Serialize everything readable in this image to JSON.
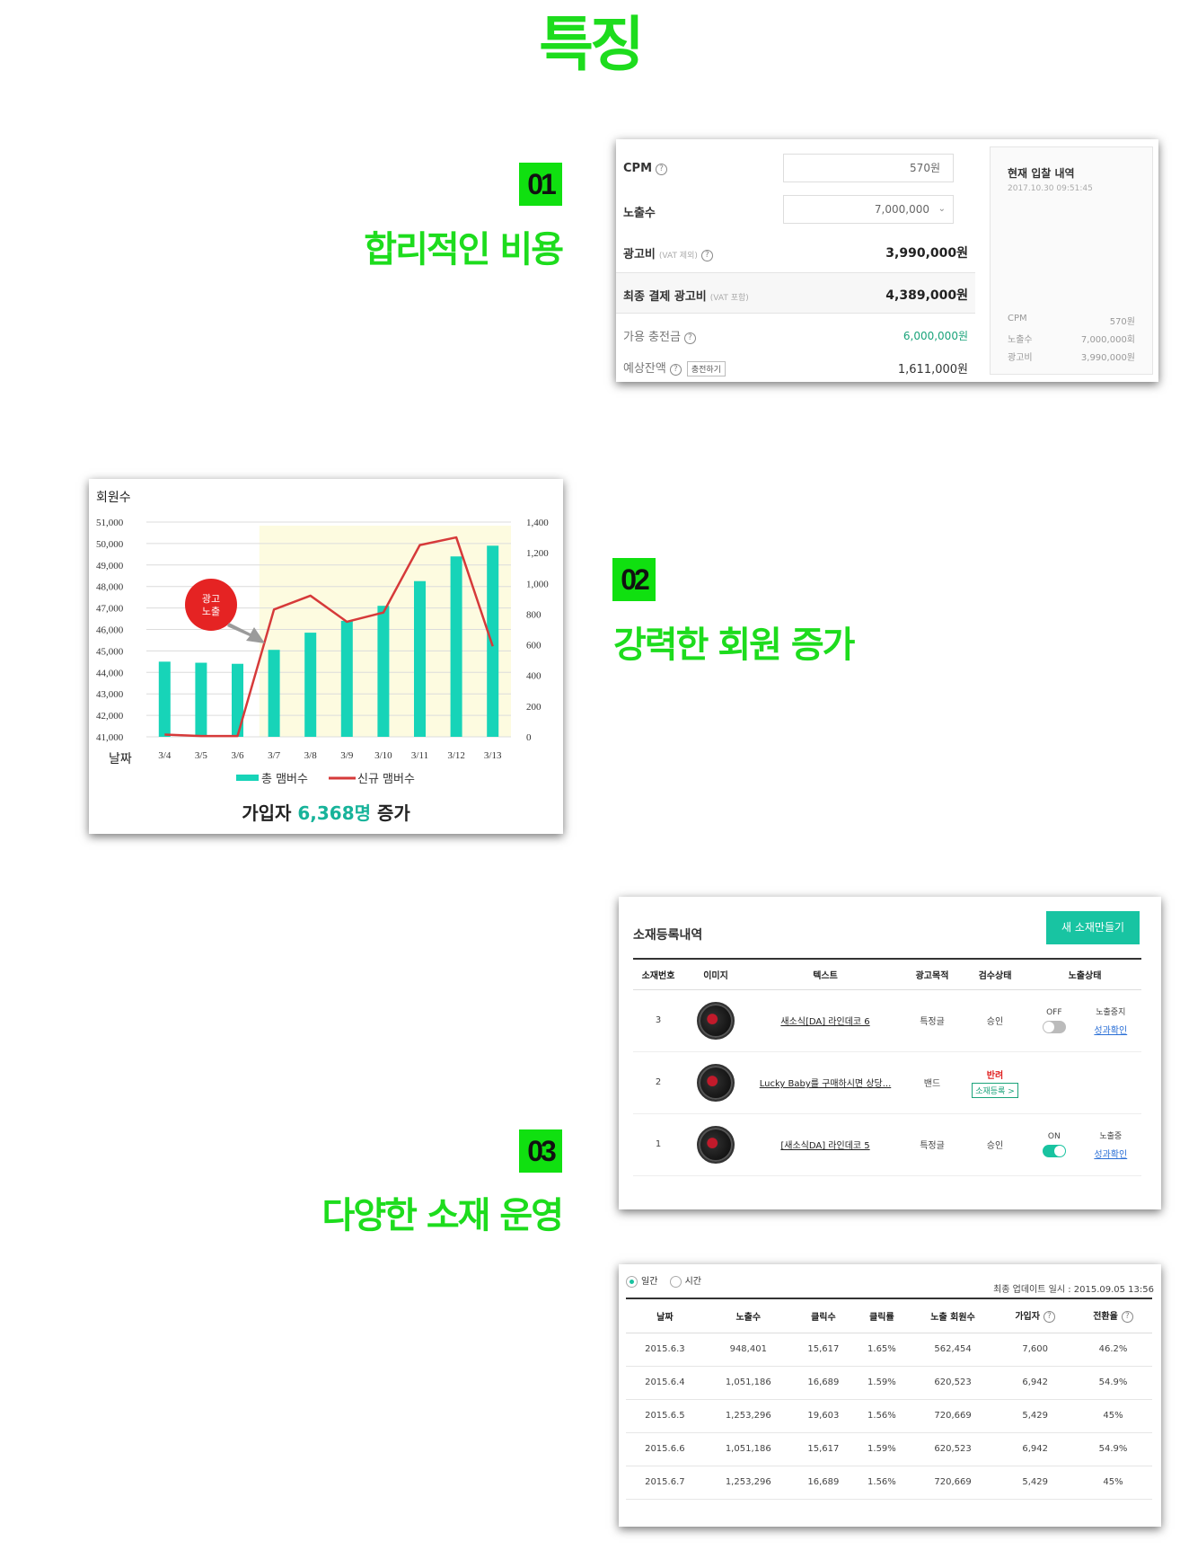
{
  "page": {
    "title": "특징"
  },
  "features": [
    {
      "number": "01",
      "title": "합리적인 비용"
    },
    {
      "number": "02",
      "title": "강력한 회원 증가"
    },
    {
      "number": "03",
      "title": "다양한 소재 운영"
    }
  ],
  "cost_card": {
    "cpm_label": "CPM",
    "cpm_value": "570원",
    "impressions_label": "노출수",
    "impressions_value": "7,000,000",
    "ad_cost_label": "광고비",
    "ad_cost_sub": "(VAT 제외)",
    "ad_cost_value": "3,990,000원",
    "final_label": "최종 결제 광고비",
    "final_sub": "(VAT 포함)",
    "final_value": "4,389,000원",
    "available_label": "가용 충전금",
    "available_value": "6,000,000원",
    "expected_label": "예상잔액",
    "charge_button": "충전하기",
    "expected_value": "1,611,000원",
    "history": {
      "title": "현재 입찰 내역",
      "timestamp": "2017.10.30 09:51:45",
      "rows": [
        {
          "label": "CPM",
          "value": "570원"
        },
        {
          "label": "노출수",
          "value": "7,000,000회"
        },
        {
          "label": "광고비",
          "value": "3,990,000원"
        }
      ]
    }
  },
  "member_card": {
    "caption_prefix": "가입자 ",
    "caption_highlight": "6,368명",
    "caption_suffix": " 증가",
    "callout": "광고\n노출"
  },
  "chart_data": {
    "type": "bar",
    "title": "",
    "ylabel": "회원수",
    "xlabel": "날짜",
    "categories": [
      "3/4",
      "3/5",
      "3/6",
      "3/7",
      "3/8",
      "3/9",
      "3/10",
      "3/11",
      "3/12",
      "3/13"
    ],
    "left_axis": {
      "min": 41000,
      "max": 51000,
      "ticks": [
        "41,000",
        "42,000",
        "43,000",
        "44,000",
        "45,000",
        "46,000",
        "47,000",
        "48,000",
        "49,000",
        "50,000",
        "51,000"
      ]
    },
    "right_axis": {
      "min": 0,
      "max": 1400,
      "ticks": [
        "0",
        "200",
        "400",
        "600",
        "800",
        "1,000",
        "1,200",
        "1,400"
      ]
    },
    "series": [
      {
        "name": "총 맴버수",
        "type": "bar",
        "axis": "left",
        "color": "#17d4b8",
        "values": [
          44500,
          44450,
          44400,
          45050,
          45850,
          46400,
          47100,
          48250,
          49400,
          49900
        ]
      },
      {
        "name": "신규 맴버수",
        "type": "line",
        "axis": "right",
        "color": "#d63a3a",
        "values": [
          15,
          5,
          5,
          830,
          920,
          750,
          810,
          1250,
          1300,
          590
        ]
      }
    ],
    "highlight_band": {
      "from": "3/7",
      "to": "3/13"
    },
    "legend": "bottom",
    "grid": true
  },
  "creative_card": {
    "title": "소재등록내역",
    "new_button": "새 소재만들기",
    "columns": [
      "소재번호",
      "이미지",
      "텍스트",
      "광고목적",
      "검수상태",
      "노출상태"
    ],
    "rows": [
      {
        "id": "3",
        "text": "새소식[DA] 라인데코 6",
        "purpose": "특정글",
        "review": "승인",
        "toggle_label": "OFF",
        "toggle": "off",
        "status": "노출중지",
        "status_link": "성과확인"
      },
      {
        "id": "2",
        "text": "Lucky Baby를 구매하시면 상당...",
        "purpose": "밴드",
        "review": "반려",
        "review_action": "소재등록 >",
        "toggle_label": "",
        "toggle": "",
        "status": "",
        "status_link": ""
      },
      {
        "id": "1",
        "text": "[새소식DA] 라인데코 5",
        "purpose": "특정글",
        "review": "승인",
        "toggle_label": "ON",
        "toggle": "on",
        "status": "노출중",
        "status_link": "성과확인"
      }
    ]
  },
  "stats_card": {
    "radio_daily": "일간",
    "radio_hourly": "시간",
    "updated": "최종 업데이트 일시 : 2015.09.05 13:56",
    "columns": [
      "날짜",
      "노출수",
      "클릭수",
      "클릭률",
      "노출 회원수",
      "가입자",
      "전환율"
    ],
    "rows": [
      [
        "2015.6.3",
        "948,401",
        "15,617",
        "1.65%",
        "562,454",
        "7,600",
        "46.2%"
      ],
      [
        "2015.6.4",
        "1,051,186",
        "16,689",
        "1.59%",
        "620,523",
        "6,942",
        "54.9%"
      ],
      [
        "2015.6.5",
        "1,253,296",
        "19,603",
        "1.56%",
        "720,669",
        "5,429",
        "45%"
      ],
      [
        "2015.6.6",
        "1,051,186",
        "15,617",
        "1.59%",
        "620,523",
        "6,942",
        "54.9%"
      ],
      [
        "2015.6.7",
        "1,253,296",
        "16,689",
        "1.56%",
        "720,669",
        "5,429",
        "45%"
      ]
    ]
  }
}
